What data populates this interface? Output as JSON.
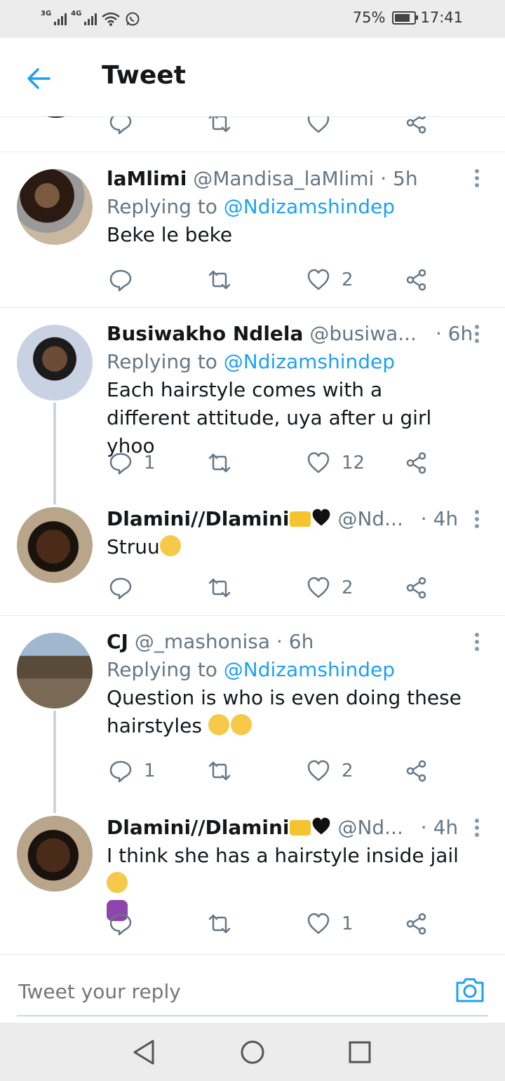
{
  "status_bar": {
    "network1": "3G",
    "network2": "4G",
    "battery": "75%",
    "time": "17:41"
  },
  "header": {
    "title": "Tweet"
  },
  "tweets": [
    {
      "name": "laMlimi",
      "handle": "@Mandisa_laMlimi",
      "time": "· 5h",
      "replying_label": "Replying to ",
      "mention": "@Ndizamshindep",
      "text": "Beke le beke",
      "reply_count": "",
      "retweet_count": "",
      "like_count": "2"
    },
    {
      "name": "Busiwakho Ndlela",
      "handle": "@busiwa...",
      "time": "· 6h",
      "replying_label": "Replying to ",
      "mention": "@Ndizamshindep",
      "text": "Each hairstyle comes with a different attitude, uya after u girl yhoo",
      "reply_count": "1",
      "retweet_count": "",
      "like_count": "12"
    },
    {
      "name": "Dlamini//Dlamini",
      "handle": "@Nd...",
      "time": "· 4h",
      "text": "Struu",
      "reply_count": "",
      "retweet_count": "",
      "like_count": "2"
    },
    {
      "name": "CJ",
      "handle": "@_mashonisa",
      "time": "· 6h",
      "replying_label": "Replying to ",
      "mention": "@Ndizamshindep",
      "text": "Question is who is even doing these hairstyles",
      "reply_count": "1",
      "retweet_count": "",
      "like_count": "2"
    },
    {
      "name": "Dlamini//Dlamini",
      "handle": "@Nd...",
      "time": "· 4h",
      "text": "I think she has a hairstyle inside jail",
      "reply_count": "",
      "retweet_count": "",
      "like_count": "1"
    }
  ],
  "composer": {
    "placeholder": "Tweet your reply"
  },
  "colors": {
    "accent": "#1da1f2",
    "secondary_text": "#657786",
    "primary_text": "#14171a"
  }
}
